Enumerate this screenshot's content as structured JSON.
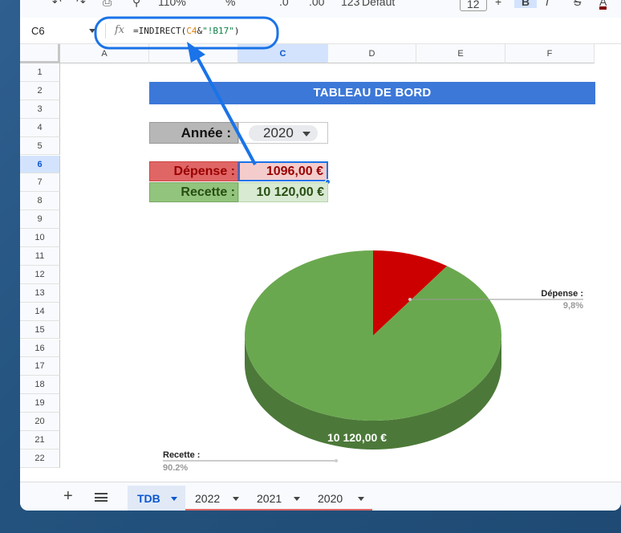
{
  "toolbar": {
    "zoom": "110%",
    "format": ".0",
    "decimals": ".00",
    "number_format": "123",
    "font": "Défaut",
    "font_size": "12",
    "bold": "B",
    "italic": "I",
    "strike": "S",
    "text_color": "A"
  },
  "formula_bar": {
    "cell_ref": "C6",
    "formula_prefix": "=INDIRECT(",
    "formula_ref": "C4",
    "formula_concat": "&",
    "formula_string": "\"!B17\"",
    "formula_suffix": ")"
  },
  "columns": [
    "A",
    "B",
    "C",
    "D",
    "E",
    "F"
  ],
  "selected_column": "C",
  "rows": [
    "1",
    "2",
    "3",
    "4",
    "5",
    "6",
    "7",
    "8",
    "9",
    "10",
    "11",
    "12",
    "13",
    "14",
    "15",
    "16",
    "17",
    "18",
    "19",
    "20",
    "21",
    "22"
  ],
  "selected_row": "6",
  "sheet": {
    "title": "TABLEAU DE BORD",
    "annee_label": "Année :",
    "annee_value": "2020",
    "depense_label": "Dépense :",
    "depense_value": "1096,00 €",
    "recette_label": "Recette  :",
    "recette_value": "10 120,00 €"
  },
  "chart_data": {
    "type": "pie",
    "style": "3d",
    "categories": [
      "Dépense :",
      "Recette  :"
    ],
    "values": [
      1096.0,
      10120.0
    ],
    "percent_labels": [
      "9,8%",
      "90,2%"
    ],
    "colors": [
      "#cc0000",
      "#6aa84f"
    ],
    "slice_value_label": "10 120,00 €",
    "legend": "none"
  },
  "annotation": {
    "color": "#1a73e8"
  },
  "tabs": [
    {
      "label": "TDB",
      "active": true,
      "stripe": ""
    },
    {
      "label": "2022",
      "active": false,
      "stripe": "#e06666"
    },
    {
      "label": "2021",
      "active": false,
      "stripe": "#e06666"
    },
    {
      "label": "2020",
      "active": false,
      "stripe": "#e06666"
    }
  ]
}
